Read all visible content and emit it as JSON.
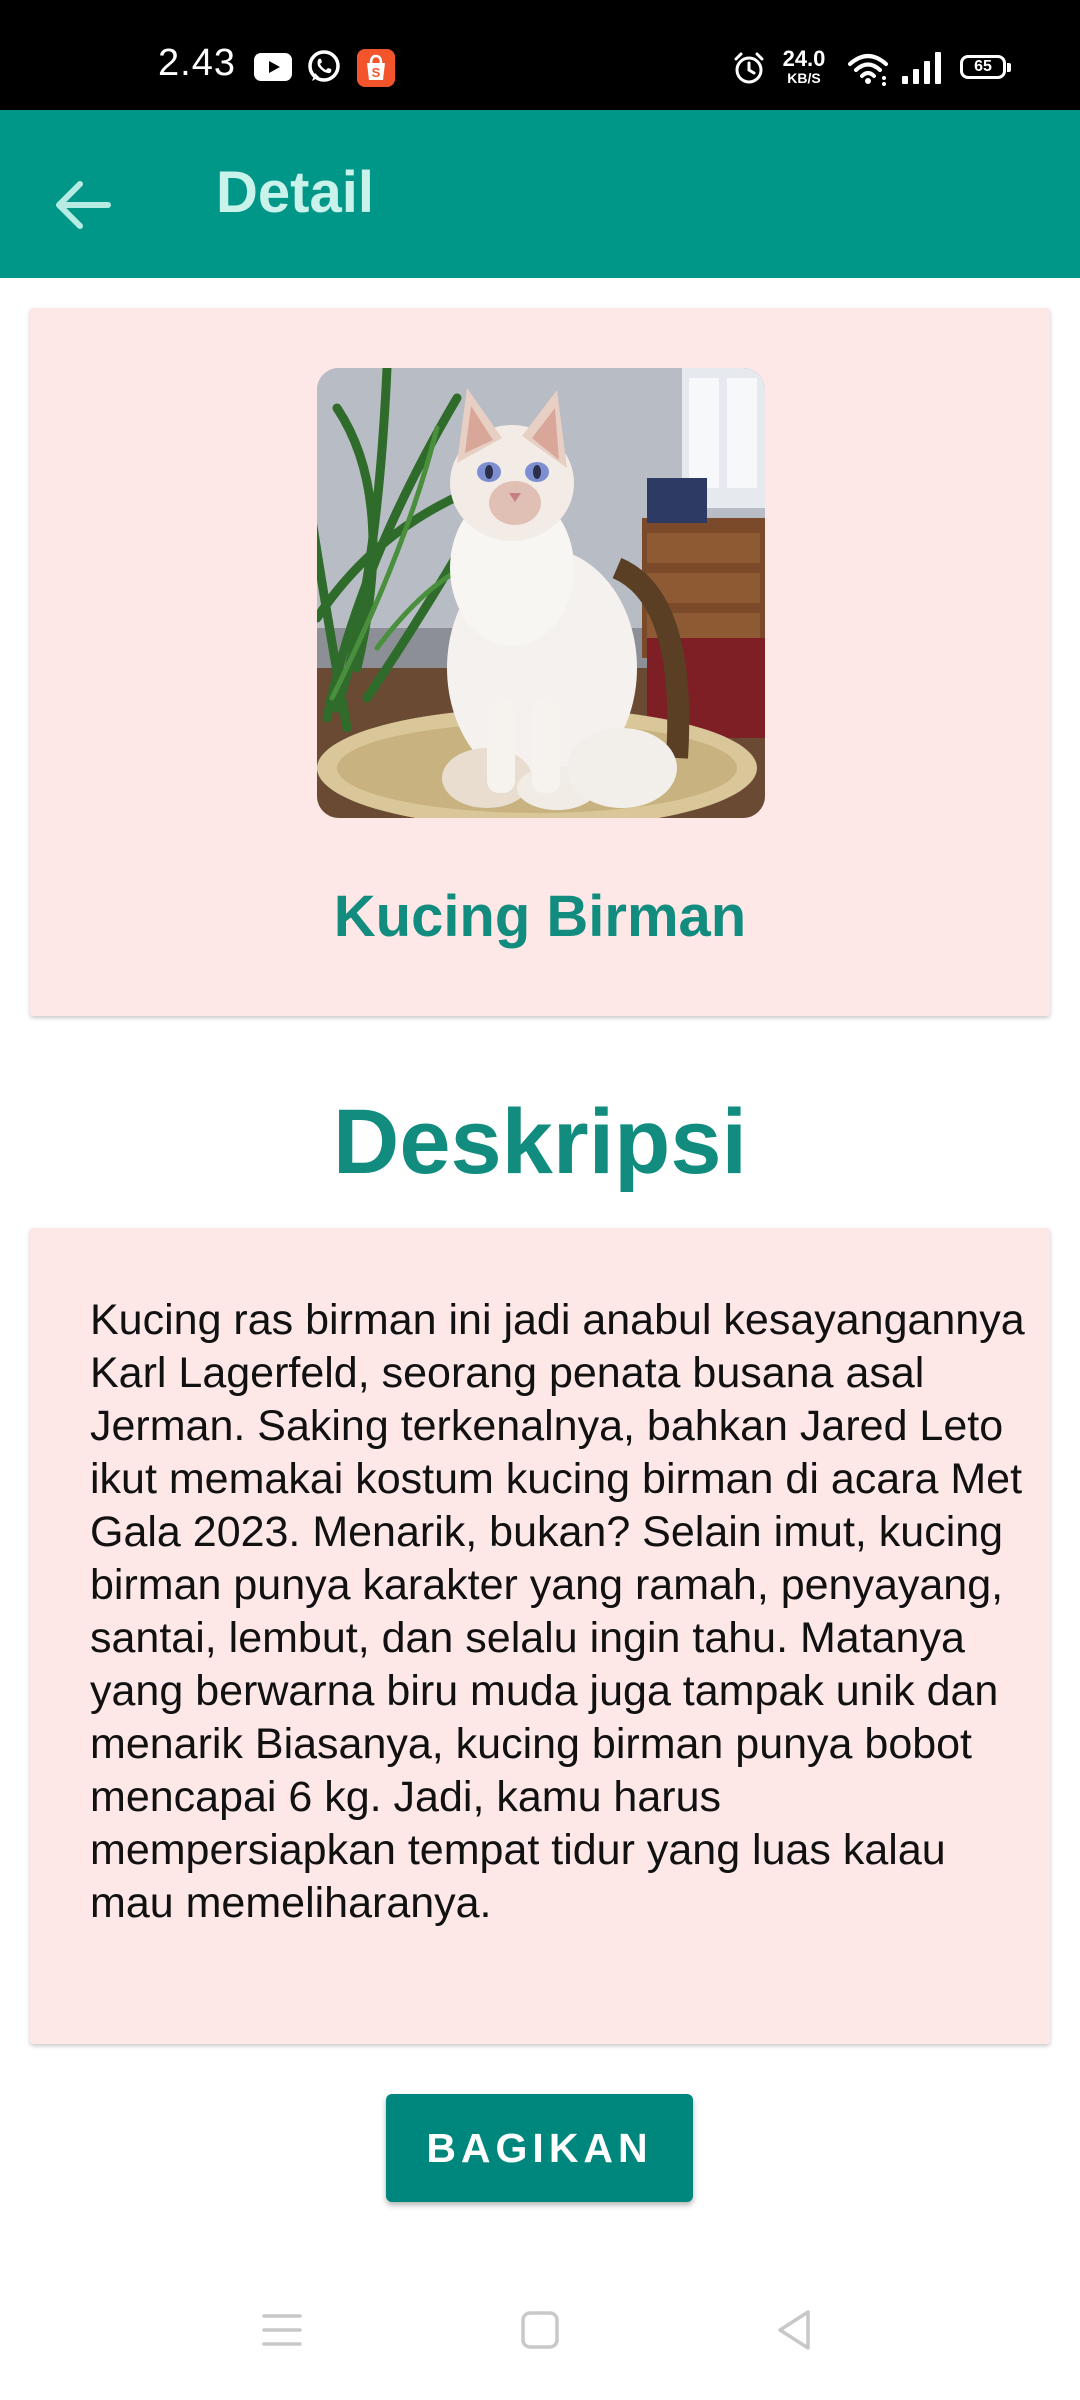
{
  "status_bar": {
    "time": "2.43",
    "net_speed_value": "24.0",
    "net_speed_unit": "KB/S",
    "battery_level": "65",
    "icons": [
      "youtube-icon",
      "whatsapp-icon",
      "shopee-icon",
      "alarm-icon",
      "wifi-icon",
      "signal-icon",
      "battery-icon"
    ]
  },
  "app_bar": {
    "title": "Detail",
    "back_icon": "arrow-back-icon",
    "background_color": "#009688"
  },
  "detail": {
    "image_description": "white birman cat photo",
    "name": "Kucing Birman"
  },
  "description": {
    "heading": "Deskripsi",
    "text": "Kucing ras birman ini jadi anabul kesayangannya Karl Lagerfeld, seorang penata busana asal Jerman. Saking terkenalnya, bahkan Jared Leto ikut memakai kostum kucing birman di acara Met Gala 2023. Menarik, bukan? Selain imut, kucing birman punya karakter yang ramah, penyayang, santai, lembut, dan selalu ingin tahu. Matanya yang berwarna biru muda juga tampak unik dan menarik Biasanya, kucing birman punya bobot mencapai 6 kg. Jadi, kamu harus mempersiapkan tempat tidur yang luas kalau mau memeliharanya."
  },
  "share_button": {
    "label": "BAGIKAN"
  },
  "nav_bar": {
    "icons": [
      "menu-icon",
      "home-icon",
      "back-icon"
    ]
  },
  "colors": {
    "accent": "#009688",
    "title_teal": "#128c7e",
    "card_background": "#fde7e7",
    "button": "#00877d"
  }
}
